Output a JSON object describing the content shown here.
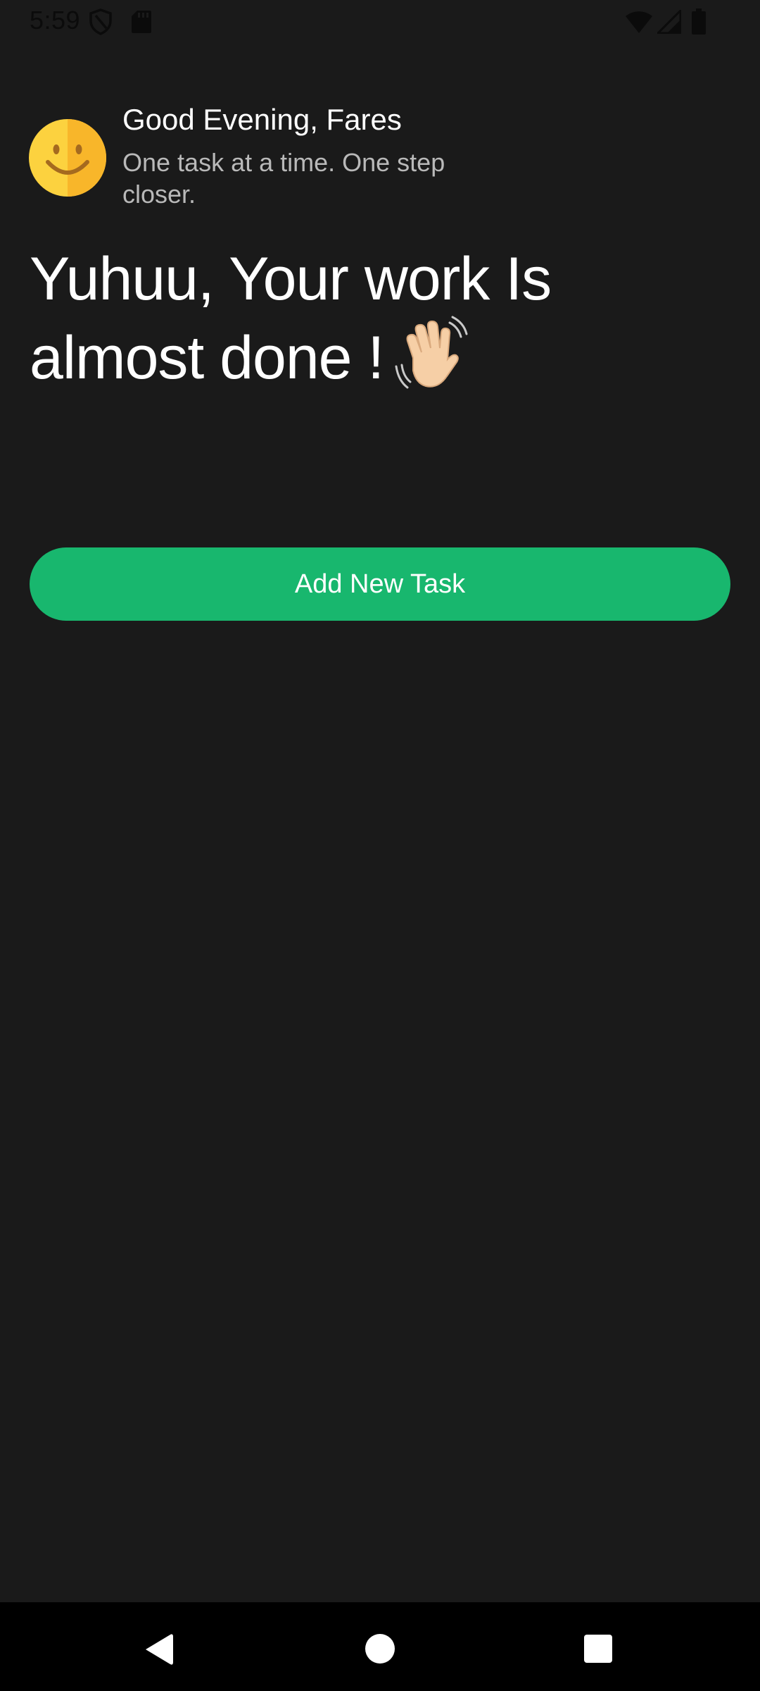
{
  "status_bar": {
    "time": "5:59",
    "icons": [
      "shield-icon",
      "sd-card-icon",
      "wifi-icon",
      "signal-icon",
      "battery-icon"
    ]
  },
  "header": {
    "avatar_icon": "smiley-face-icon",
    "greeting": "Good Evening, Fares",
    "subtitle": "One task at a time. One step closer."
  },
  "headline": {
    "line1": "Yuhuu, Your work Is",
    "line2": "almost done !",
    "emoji_icon": "waving-hand-icon"
  },
  "actions": {
    "add_task_label": "Add New Task"
  },
  "nav_bar": {
    "icons": [
      "back-icon",
      "home-icon",
      "recents-icon"
    ]
  },
  "colors": {
    "background": "#1a1a1a",
    "accent": "#18b76e",
    "text_primary": "#ffffff",
    "text_secondary": "#b9b9b9",
    "nav_background": "#000000"
  }
}
